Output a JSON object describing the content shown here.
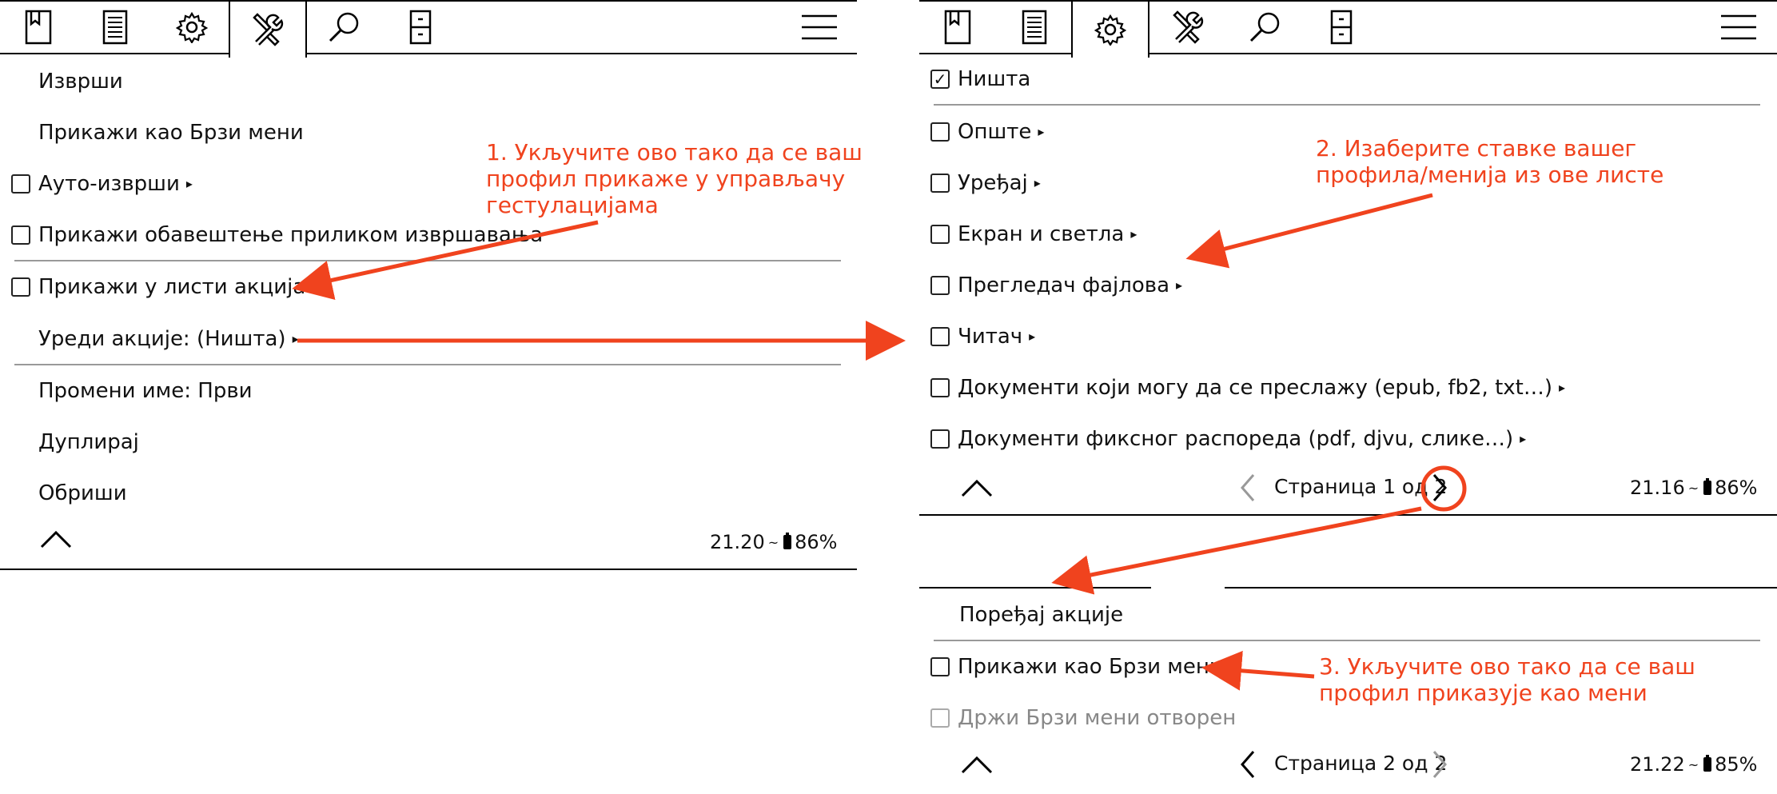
{
  "left": {
    "tabs": [
      "bookmark-icon",
      "document-list-icon",
      "gear-icon",
      "tools-icon",
      "search-icon",
      "file-cabinet-icon"
    ],
    "active_tab": 3,
    "items": [
      {
        "label": "Изврши",
        "checkbox": false
      },
      {
        "label": "Прикажи као Брзи мени",
        "checkbox": false
      },
      {
        "label": "Ауто-изврши",
        "checkbox": true,
        "checked": false,
        "arrow": "▸"
      },
      {
        "label": "Прикажи обавештење приликом извршавања",
        "checkbox": true,
        "checked": false
      },
      {
        "label": "Прикажи у листи акција",
        "checkbox": true,
        "checked": false
      },
      {
        "label": "Уреди акције: (Ништа)",
        "checkbox": false,
        "arrow": "▸"
      },
      {
        "label": "Промени име: Први",
        "checkbox": false
      },
      {
        "label": "Дуплирај",
        "checkbox": false
      },
      {
        "label": "Обриши",
        "checkbox": false
      }
    ],
    "status": {
      "time": "21.20",
      "battery": "86%"
    }
  },
  "right_top": {
    "tabs": [
      "bookmark-icon",
      "document-list-icon",
      "gear-icon",
      "tools-icon",
      "search-icon",
      "file-cabinet-icon"
    ],
    "active_tab": 2,
    "items": [
      {
        "label": "Ништа",
        "checked": true
      },
      {
        "label": "Опште",
        "checked": false,
        "arrow": "▸"
      },
      {
        "label": "Уређај",
        "checked": false,
        "arrow": "▸"
      },
      {
        "label": "Екран и светла",
        "checked": false,
        "arrow": "▸"
      },
      {
        "label": "Прегледач фајлова",
        "checked": false,
        "arrow": "▸"
      },
      {
        "label": "Читач",
        "checked": false,
        "arrow": "▸"
      },
      {
        "label": "Документи који могу да се преслажу (epub, fb2, txt…)",
        "checked": false,
        "arrow": "▸"
      },
      {
        "label": "Документи фиксног распореда (pdf, djvu, слике…)",
        "checked": false,
        "arrow": "▸"
      }
    ],
    "pager": "Страница 1 од 2",
    "status": {
      "time": "21.16",
      "battery": "86%"
    }
  },
  "right_bottom": {
    "heading": "Поређај акције",
    "items": [
      {
        "label": "Прикажи као Брзи мени",
        "checked": false,
        "disabled": false
      },
      {
        "label": "Држи Брзи мени отворен",
        "checked": false,
        "disabled": true
      }
    ],
    "pager": "Страница 2 од 2",
    "status": {
      "time": "21.22",
      "battery": "85%"
    }
  },
  "annotations": {
    "note1": "1. Укључите ово тако да се ваш\nпрофил прикаже у управљачу\nгестулацијама",
    "note2": "2. Изаберите ставке вашег\nпрофила/менија из ове листе",
    "note3": "3. Укључите ово тако да се ваш\nпрофил приказује као мени",
    "color": "#f0431e"
  },
  "glyphs": {
    "check": "☑",
    "checkmark": "✓",
    "up": "︿",
    "prev": "❮",
    "next": "❯",
    "sep": "~"
  }
}
